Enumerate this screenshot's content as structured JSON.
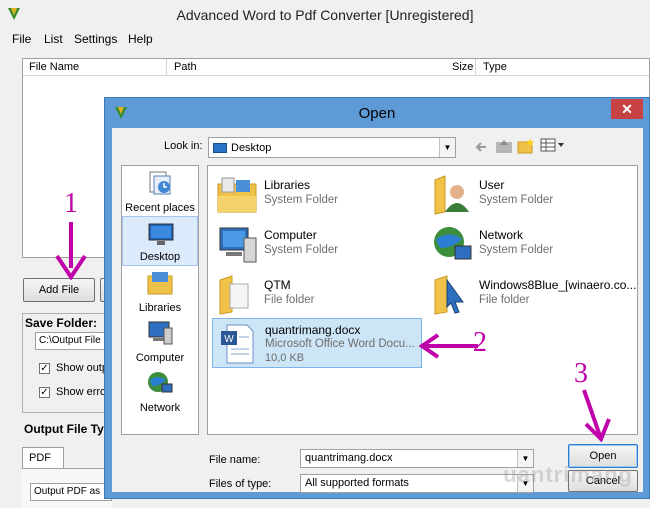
{
  "main": {
    "title": "Advanced Word to Pdf Converter [Unregistered]",
    "menu": [
      "File",
      "List",
      "Settings",
      "Help"
    ],
    "columns": [
      "File Name",
      "Path",
      "Size",
      "Type"
    ],
    "add_file_label": "Add File",
    "save_folder_label": "Save Folder:",
    "save_folder_value": "C:\\Output File",
    "show_output_label": "Show outp",
    "show_errors_label": "Show erro",
    "output_file_type_label": "Output File Typ",
    "pdf_tab_label": "PDF",
    "output_pdf_label": "Output PDF as"
  },
  "annotations": [
    "1",
    "2",
    "3"
  ],
  "dialog": {
    "title": "Open",
    "close_label": "✕",
    "look_in_label": "Look in:",
    "look_in_value": "Desktop",
    "places": [
      {
        "label": "Recent places",
        "icon": "recent-places-icon"
      },
      {
        "label": "Desktop",
        "icon": "desktop-icon",
        "selected": true
      },
      {
        "label": "Libraries",
        "icon": "libraries-icon"
      },
      {
        "label": "Computer",
        "icon": "computer-icon"
      },
      {
        "label": "Network",
        "icon": "network-icon"
      }
    ],
    "items": [
      {
        "name": "Libraries",
        "sub": "System Folder",
        "icon": "libraries-folder-icon"
      },
      {
        "name": "User",
        "sub": "System Folder",
        "icon": "user-folder-icon"
      },
      {
        "name": "Computer",
        "sub": "System Folder",
        "icon": "computer-icon"
      },
      {
        "name": "Network",
        "sub": "System Folder",
        "icon": "network-icon"
      },
      {
        "name": "QTM",
        "sub": "File folder",
        "icon": "folder-icon"
      },
      {
        "name": "Windows8Blue_[winaero.co...",
        "sub": "File folder",
        "icon": "folder-icon"
      },
      {
        "name": "quantrimang.docx",
        "sub": "Microsoft Office Word Docu...",
        "size": "10,0 KB",
        "icon": "word-document-icon",
        "selected": true
      }
    ],
    "file_name_label": "File name:",
    "file_name_value": "quantrimang.docx",
    "files_of_type_label": "Files of type:",
    "files_of_type_value": "All supported formats",
    "open_label": "Open",
    "cancel_label": "Cancel"
  },
  "watermark": "uantrimang"
}
